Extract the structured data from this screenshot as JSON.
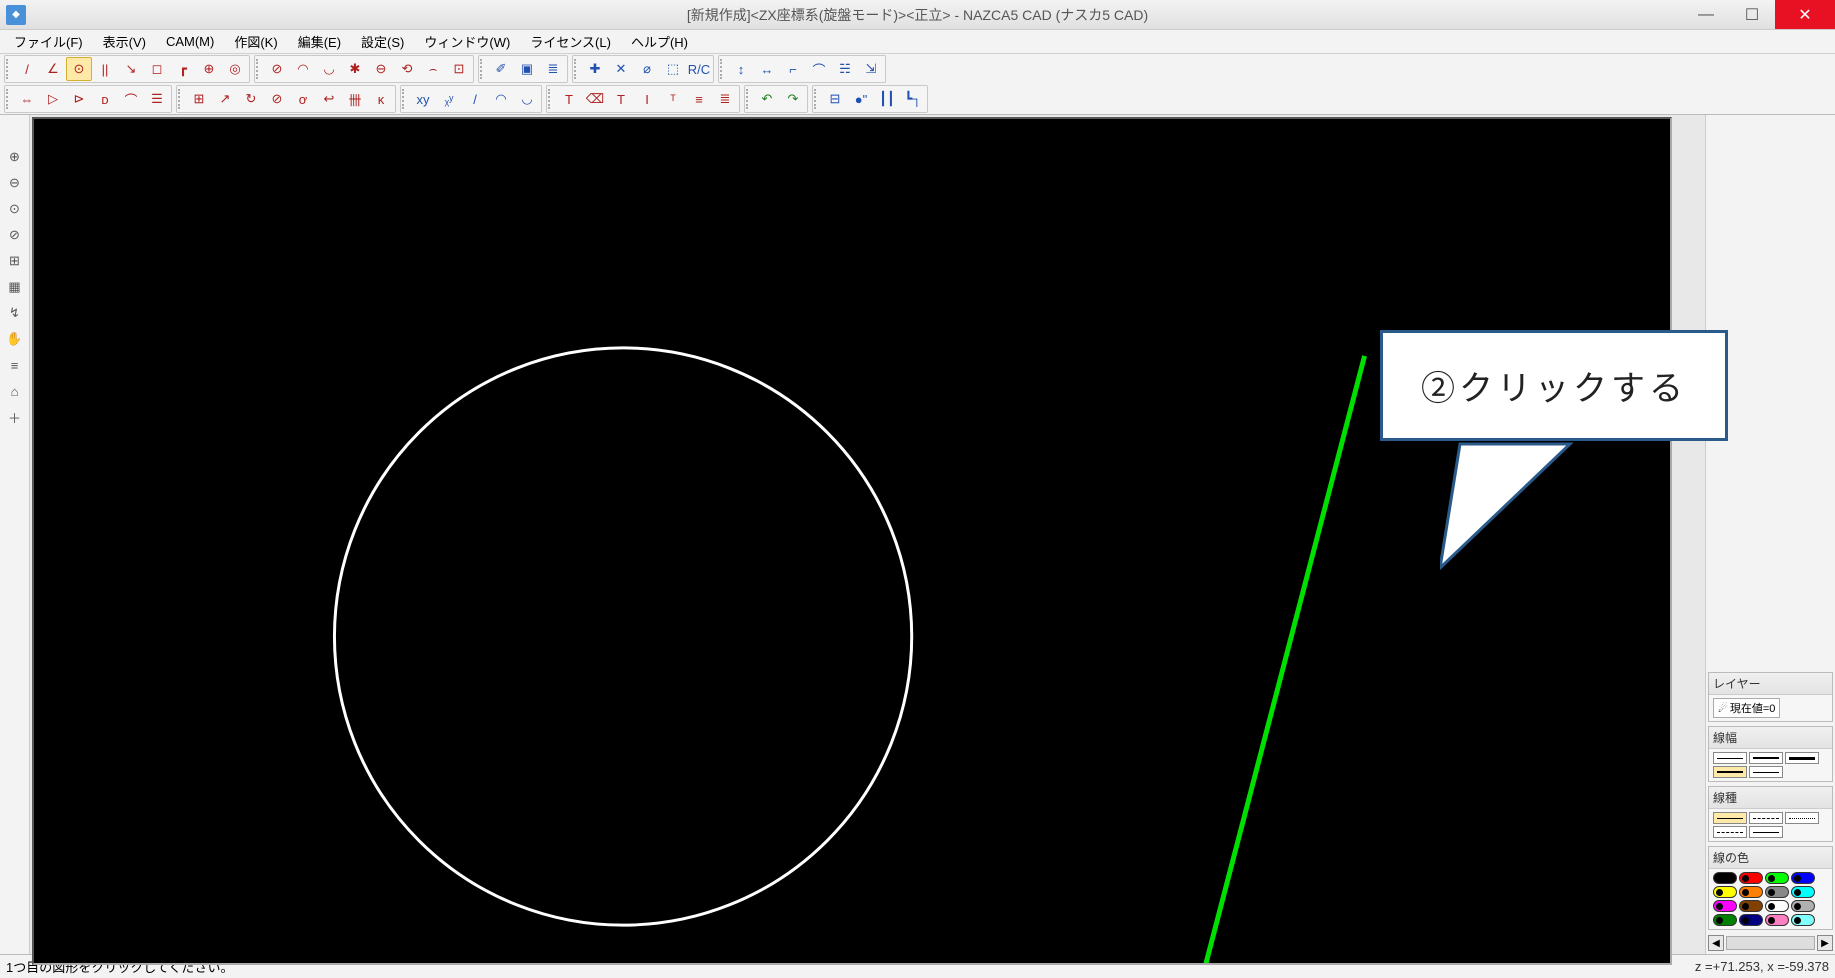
{
  "window": {
    "title": "[新規作成]<ZX座標系(旋盤モード)><正立> - NAZCA5 CAD (ナスカ5 CAD)"
  },
  "menu": {
    "file": "ファイル(F)",
    "view": "表示(V)",
    "cam": "CAM(M)",
    "draw": "作図(K)",
    "edit": "編集(E)",
    "settings": "設定(S)",
    "window": "ウィンドウ(W)",
    "license": "ライセンス(L)",
    "help": "ヘルプ(H)"
  },
  "callout": {
    "text": "②クリックする"
  },
  "right_panel": {
    "layer_label": "レイヤー",
    "layer_value": "現在値=0",
    "linewidth_label": "線幅",
    "linetype_label": "線種",
    "linecolor_label": "線の色"
  },
  "status": {
    "message": "1つ目の図形をクリックしてください。",
    "coords": "z =+71.253,    x =-59.378"
  },
  "colors": {
    "palette": [
      "#000000",
      "#ff0000",
      "#00ff00",
      "#0000ff",
      "#ffff00",
      "#ff8000",
      "#888888",
      "#00ffff",
      "#ff00ff",
      "#804000",
      "#ffffff",
      "#b0b0b0",
      "#008000",
      "#000080",
      "#ff80c0",
      "#80ffff"
    ]
  },
  "icons": {
    "row1_g1": [
      "/",
      "∠",
      "⊙",
      "||",
      "↘",
      "◻",
      "┏",
      "⊕",
      "◎"
    ],
    "row1_g2": [
      "⊘",
      "◠",
      "◡",
      "✱",
      "⊖",
      "⟲",
      "⌢",
      "⊡"
    ],
    "row1_g3": [
      "✐",
      "▣",
      "≣"
    ],
    "row1_g4": [
      "✚",
      "✕",
      "⌀",
      "⬚",
      "R/C"
    ],
    "row1_g5": [
      "↕",
      "↔",
      "⌐",
      "⌒",
      "☵",
      "⇲"
    ],
    "row2_g1": [
      "⇔",
      "▷",
      "⊳",
      "ᴅ",
      "⌒",
      "☰"
    ],
    "row2_g2": [
      "⊞",
      "↗",
      "↻",
      "⊘",
      "ơ",
      "↩",
      "卌",
      "ᴋ"
    ],
    "row2_g3": [
      "xy",
      "ᵪʸ",
      "/",
      "◠",
      "◡"
    ],
    "row2_g4": [
      "T",
      "⌫",
      "T",
      "I",
      "ᵀ",
      "≡",
      "≣"
    ],
    "row2_g5": [
      "↶",
      "↷"
    ],
    "row2_g6": [
      "⊟",
      "●\"",
      "┃┃",
      "┗┐"
    ],
    "left": [
      "⊕",
      "⊖",
      "⊙",
      "⊘",
      "⊞",
      "▦",
      "↯",
      "✋",
      "≡",
      "⌂",
      "＋"
    ]
  }
}
